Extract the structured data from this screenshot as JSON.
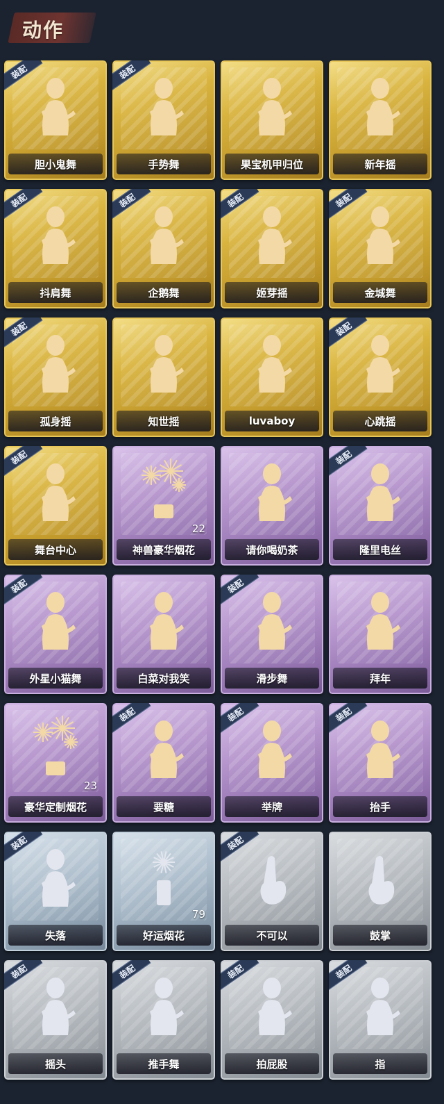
{
  "header": {
    "title": "动作"
  },
  "equip_badge": "装配",
  "colors": {
    "gold": "#d9b43f",
    "purple": "#b594cc",
    "blue": "#b1c1cf",
    "gray": "#b8bdc2",
    "figure_gold": "#f3d9a6",
    "figure_silver": "#e3e6ee"
  },
  "cards": [
    {
      "label": "胆小鬼舞",
      "rarity": "gold",
      "equipped": true,
      "icon": "figure-heart-icon"
    },
    {
      "label": "手势舞",
      "rarity": "gold",
      "equipped": true,
      "icon": "figure-gesture-icon"
    },
    {
      "label": "果宝机甲归位",
      "rarity": "gold",
      "equipped": false,
      "icon": "figure-arms-icon"
    },
    {
      "label": "新年摇",
      "rarity": "gold",
      "equipped": false,
      "icon": "figure-clap-icon"
    },
    {
      "label": "抖肩舞",
      "rarity": "gold",
      "equipped": true,
      "icon": "figure-shoulder-icon"
    },
    {
      "label": "企鹅舞",
      "rarity": "gold",
      "equipped": true,
      "icon": "figure-penguin-icon"
    },
    {
      "label": "姬芽摇",
      "rarity": "gold",
      "equipped": true,
      "icon": "figure-sway-icon"
    },
    {
      "label": "金城舞",
      "rarity": "gold",
      "equipped": true,
      "icon": "figure-wave-icon"
    },
    {
      "label": "孤身摇",
      "rarity": "gold",
      "equipped": true,
      "icon": "figure-solo-icon"
    },
    {
      "label": "知世摇",
      "rarity": "gold",
      "equipped": false,
      "icon": "figure-music-icon"
    },
    {
      "label": "luvaboy",
      "rarity": "gold",
      "equipped": false,
      "icon": "figure-spin-icon"
    },
    {
      "label": "心跳摇",
      "rarity": "gold",
      "equipped": true,
      "icon": "figure-raise-icon"
    },
    {
      "label": "舞台中心",
      "rarity": "gold",
      "equipped": true,
      "icon": "figure-stage-icon"
    },
    {
      "label": "神兽豪华烟花",
      "rarity": "purple",
      "equipped": false,
      "icon": "fireworks-icon",
      "count": "22"
    },
    {
      "label": "请你喝奶茶",
      "rarity": "purple",
      "equipped": false,
      "icon": "figure-tea-icon"
    },
    {
      "label": "隆里电丝",
      "rarity": "purple",
      "equipped": true,
      "icon": "figure-point-icon"
    },
    {
      "label": "外星小猫舞",
      "rarity": "purple",
      "equipped": true,
      "icon": "figure-cat-icon"
    },
    {
      "label": "白菜对我笑",
      "rarity": "purple",
      "equipped": false,
      "icon": "figure-smile-icon"
    },
    {
      "label": "滑步舞",
      "rarity": "purple",
      "equipped": true,
      "icon": "figure-slide-icon"
    },
    {
      "label": "拜年",
      "rarity": "purple",
      "equipped": false,
      "icon": "figure-bow-icon"
    },
    {
      "label": "豪华定制烟花",
      "rarity": "purple",
      "equipped": false,
      "icon": "fireworks-box-icon",
      "count": "23"
    },
    {
      "label": "要糖",
      "rarity": "purple",
      "equipped": true,
      "icon": "figure-ask-icon"
    },
    {
      "label": "举牌",
      "rarity": "purple",
      "equipped": true,
      "icon": "figure-sign-icon"
    },
    {
      "label": "抬手",
      "rarity": "purple",
      "equipped": true,
      "icon": "figure-lift-icon"
    },
    {
      "label": "失落",
      "rarity": "blue",
      "equipped": true,
      "icon": "figure-kneel-icon"
    },
    {
      "label": "好运烟花",
      "rarity": "blue",
      "equipped": false,
      "icon": "firecracker-icon",
      "count": "79"
    },
    {
      "label": "不可以",
      "rarity": "gray",
      "equipped": true,
      "icon": "finger-no-icon"
    },
    {
      "label": "鼓掌",
      "rarity": "gray",
      "equipped": false,
      "icon": "clap-hands-icon"
    },
    {
      "label": "摇头",
      "rarity": "gray",
      "equipped": true,
      "icon": "figure-shake-icon"
    },
    {
      "label": "推手舞",
      "rarity": "gray",
      "equipped": true,
      "icon": "figure-push-icon"
    },
    {
      "label": "拍屁股",
      "rarity": "gray",
      "equipped": true,
      "icon": "figure-pat-icon"
    },
    {
      "label": "指",
      "rarity": "gray",
      "equipped": true,
      "icon": "figure-pointing-icon"
    }
  ]
}
